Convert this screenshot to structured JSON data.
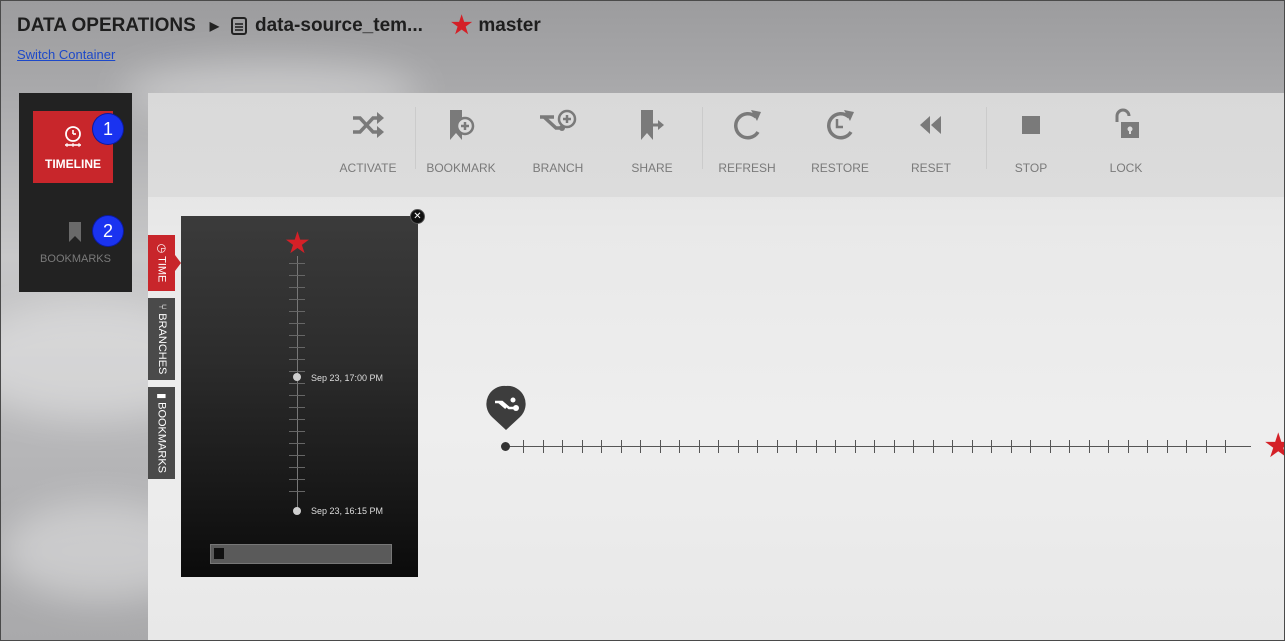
{
  "header": {
    "app_title": "DATA OPERATIONS",
    "file_name": "data-source_tem...",
    "branch_name": "master",
    "switch_link": "Switch Container"
  },
  "leftnav": {
    "items": [
      {
        "label": "TIMELINE",
        "icon": "clock-timeline-icon",
        "active": true,
        "badge": "1"
      },
      {
        "label": "BOOKMARKS",
        "icon": "bookmark-icon",
        "active": false,
        "badge": "2"
      }
    ]
  },
  "toolbar": {
    "items": [
      {
        "label": "ACTIVATE",
        "icon": "shuffle-icon"
      },
      {
        "label": "BOOKMARK",
        "icon": "bookmark-add-icon"
      },
      {
        "label": "BRANCH",
        "icon": "branch-add-icon"
      },
      {
        "label": "SHARE",
        "icon": "share-icon"
      },
      {
        "label": "REFRESH",
        "icon": "refresh-icon"
      },
      {
        "label": "RESTORE",
        "icon": "restore-icon"
      },
      {
        "label": "RESET",
        "icon": "rewind-icon"
      },
      {
        "label": "STOP",
        "icon": "stop-icon"
      },
      {
        "label": "LOCK",
        "icon": "unlock-icon"
      }
    ]
  },
  "timeline_panel": {
    "tabs": [
      {
        "label": "TIME",
        "icon": "clock-icon",
        "active": true
      },
      {
        "label": "BRANCHES",
        "icon": "branch-icon",
        "active": false
      },
      {
        "label": "BOOKMARKS",
        "icon": "bookmark-icon",
        "active": false
      }
    ],
    "markers": [
      {
        "label": "Sep 23, 17:00 PM"
      },
      {
        "label": "Sep 23, 16:15 PM"
      }
    ]
  },
  "colors": {
    "accent_red": "#c8262b",
    "star_red": "#d42027",
    "badge_blue": "#1a33f0"
  }
}
